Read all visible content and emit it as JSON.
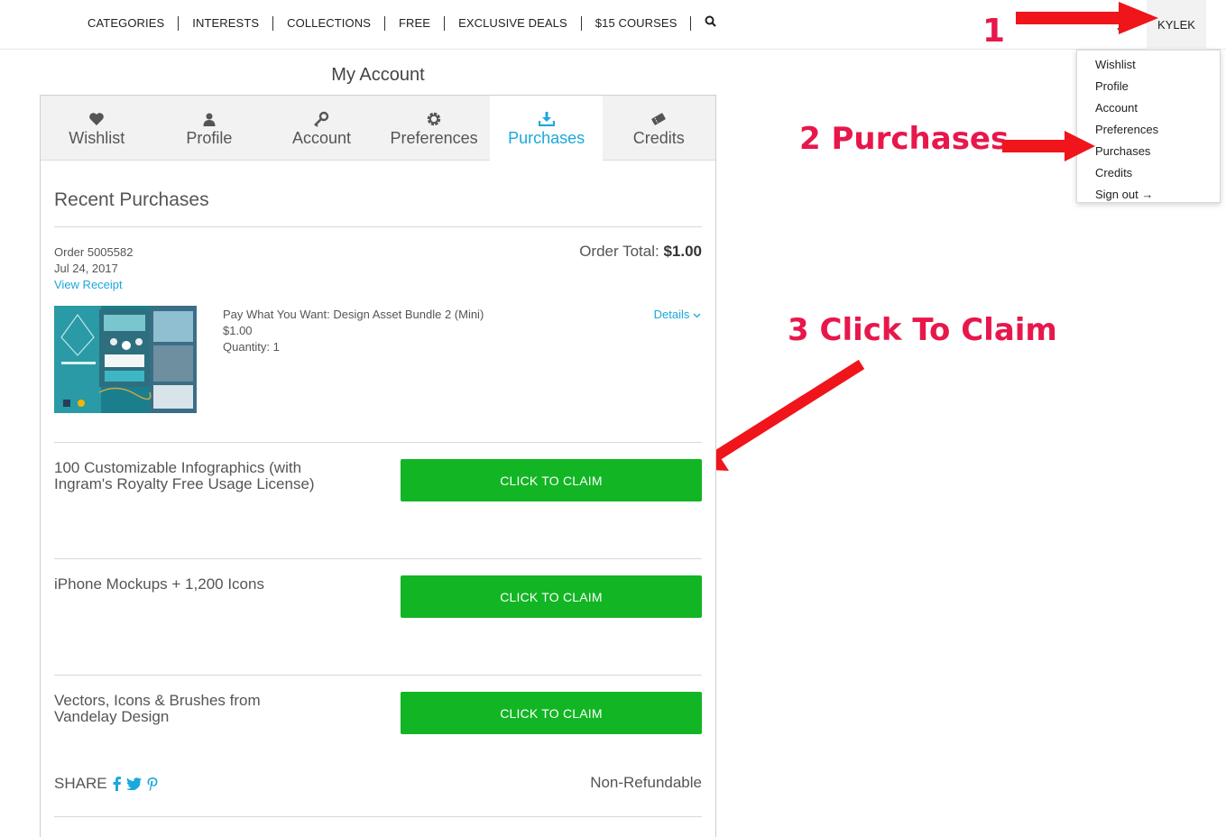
{
  "nav": {
    "items": [
      "CATEGORIES",
      "INTERESTS",
      "COLLECTIONS",
      "FREE",
      "EXCLUSIVE DEALS",
      "$15 COURSES"
    ],
    "user": "KYLEK"
  },
  "dropdown": {
    "items": [
      "Wishlist",
      "Profile",
      "Account",
      "Preferences",
      "Purchases",
      "Credits",
      "Sign out →"
    ]
  },
  "annotations": {
    "step1": "1",
    "step2": "2  Purchases",
    "step3": "3 Click To Claim"
  },
  "account": {
    "title": "My Account",
    "tabs": [
      "Wishlist",
      "Profile",
      "Account",
      "Preferences",
      "Purchases",
      "Credits"
    ],
    "active_tab": "Purchases",
    "section_title": "Recent Purchases"
  },
  "order": {
    "number": "Order 5005582",
    "date": "Jul 24, 2017",
    "receipt_link": "View Receipt",
    "total_label": "Order Total:",
    "total_value": "$1.00",
    "item": {
      "title": "Pay What You Want: Design Asset Bundle 2 (Mini)",
      "price": "$1.00",
      "quantity": "Quantity: 1",
      "details_link": "Details"
    }
  },
  "claims": [
    {
      "name": "100 Customizable Infographics (with Ingram's Royalty Free Usage License)",
      "button": "CLICK TO CLAIM"
    },
    {
      "name": "iPhone Mockups + 1,200 Icons",
      "button": "CLICK TO CLAIM"
    },
    {
      "name": "Vectors, Icons & Brushes from Vandelay Design",
      "button": "CLICK TO CLAIM"
    }
  ],
  "footer": {
    "share_label": "SHARE",
    "non_refundable": "Non-Refundable"
  },
  "colors": {
    "accent_blue": "#1ba8dc",
    "claim_green": "#12b524",
    "annotation_red": "#e8174b",
    "arrow_red": "#f0141b"
  },
  "icons": [
    "search-icon",
    "cart-icon",
    "heart-icon",
    "user-icon",
    "key-icon",
    "gear-icon",
    "download-icon",
    "ticket-icon",
    "chevron-down-icon",
    "facebook-icon",
    "twitter-icon",
    "pinterest-icon"
  ]
}
